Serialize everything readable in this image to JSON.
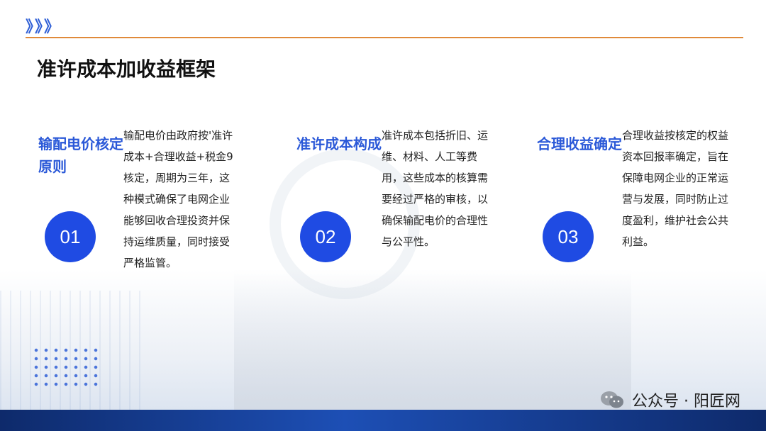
{
  "header": {
    "chevrons": "》》》",
    "title": "准许成本加收益框架"
  },
  "columns": [
    {
      "heading": "输配电价核定原则",
      "number": "01",
      "text": "输配电价由政府按'准许成本+合理收益+税金9核定，周期为三年，这种模式确保了电网企业能够回收合理投资并保持运维质量，同时接受严格监管。"
    },
    {
      "heading": "准许成本构成",
      "number": "02",
      "text": "准许成本包括折旧、运维、材料、人工等费用，这些成本的核算需要经过严格的审核，以确保输配电价的合理性与公平性。"
    },
    {
      "heading": "合理收益确定",
      "number": "03",
      "text": "合理收益按核定的权益资本回报率确定，旨在保障电网企业的正常运营与发展，同时防止过度盈利，维护社会公共利益。"
    }
  ],
  "watermark": {
    "icon": "wechat-icon",
    "text": "公众号 · 阳匠网"
  },
  "colors": {
    "accent_blue": "#2b59d8",
    "circle_blue": "#1f4be3",
    "orange_line": "#e08a3a"
  }
}
